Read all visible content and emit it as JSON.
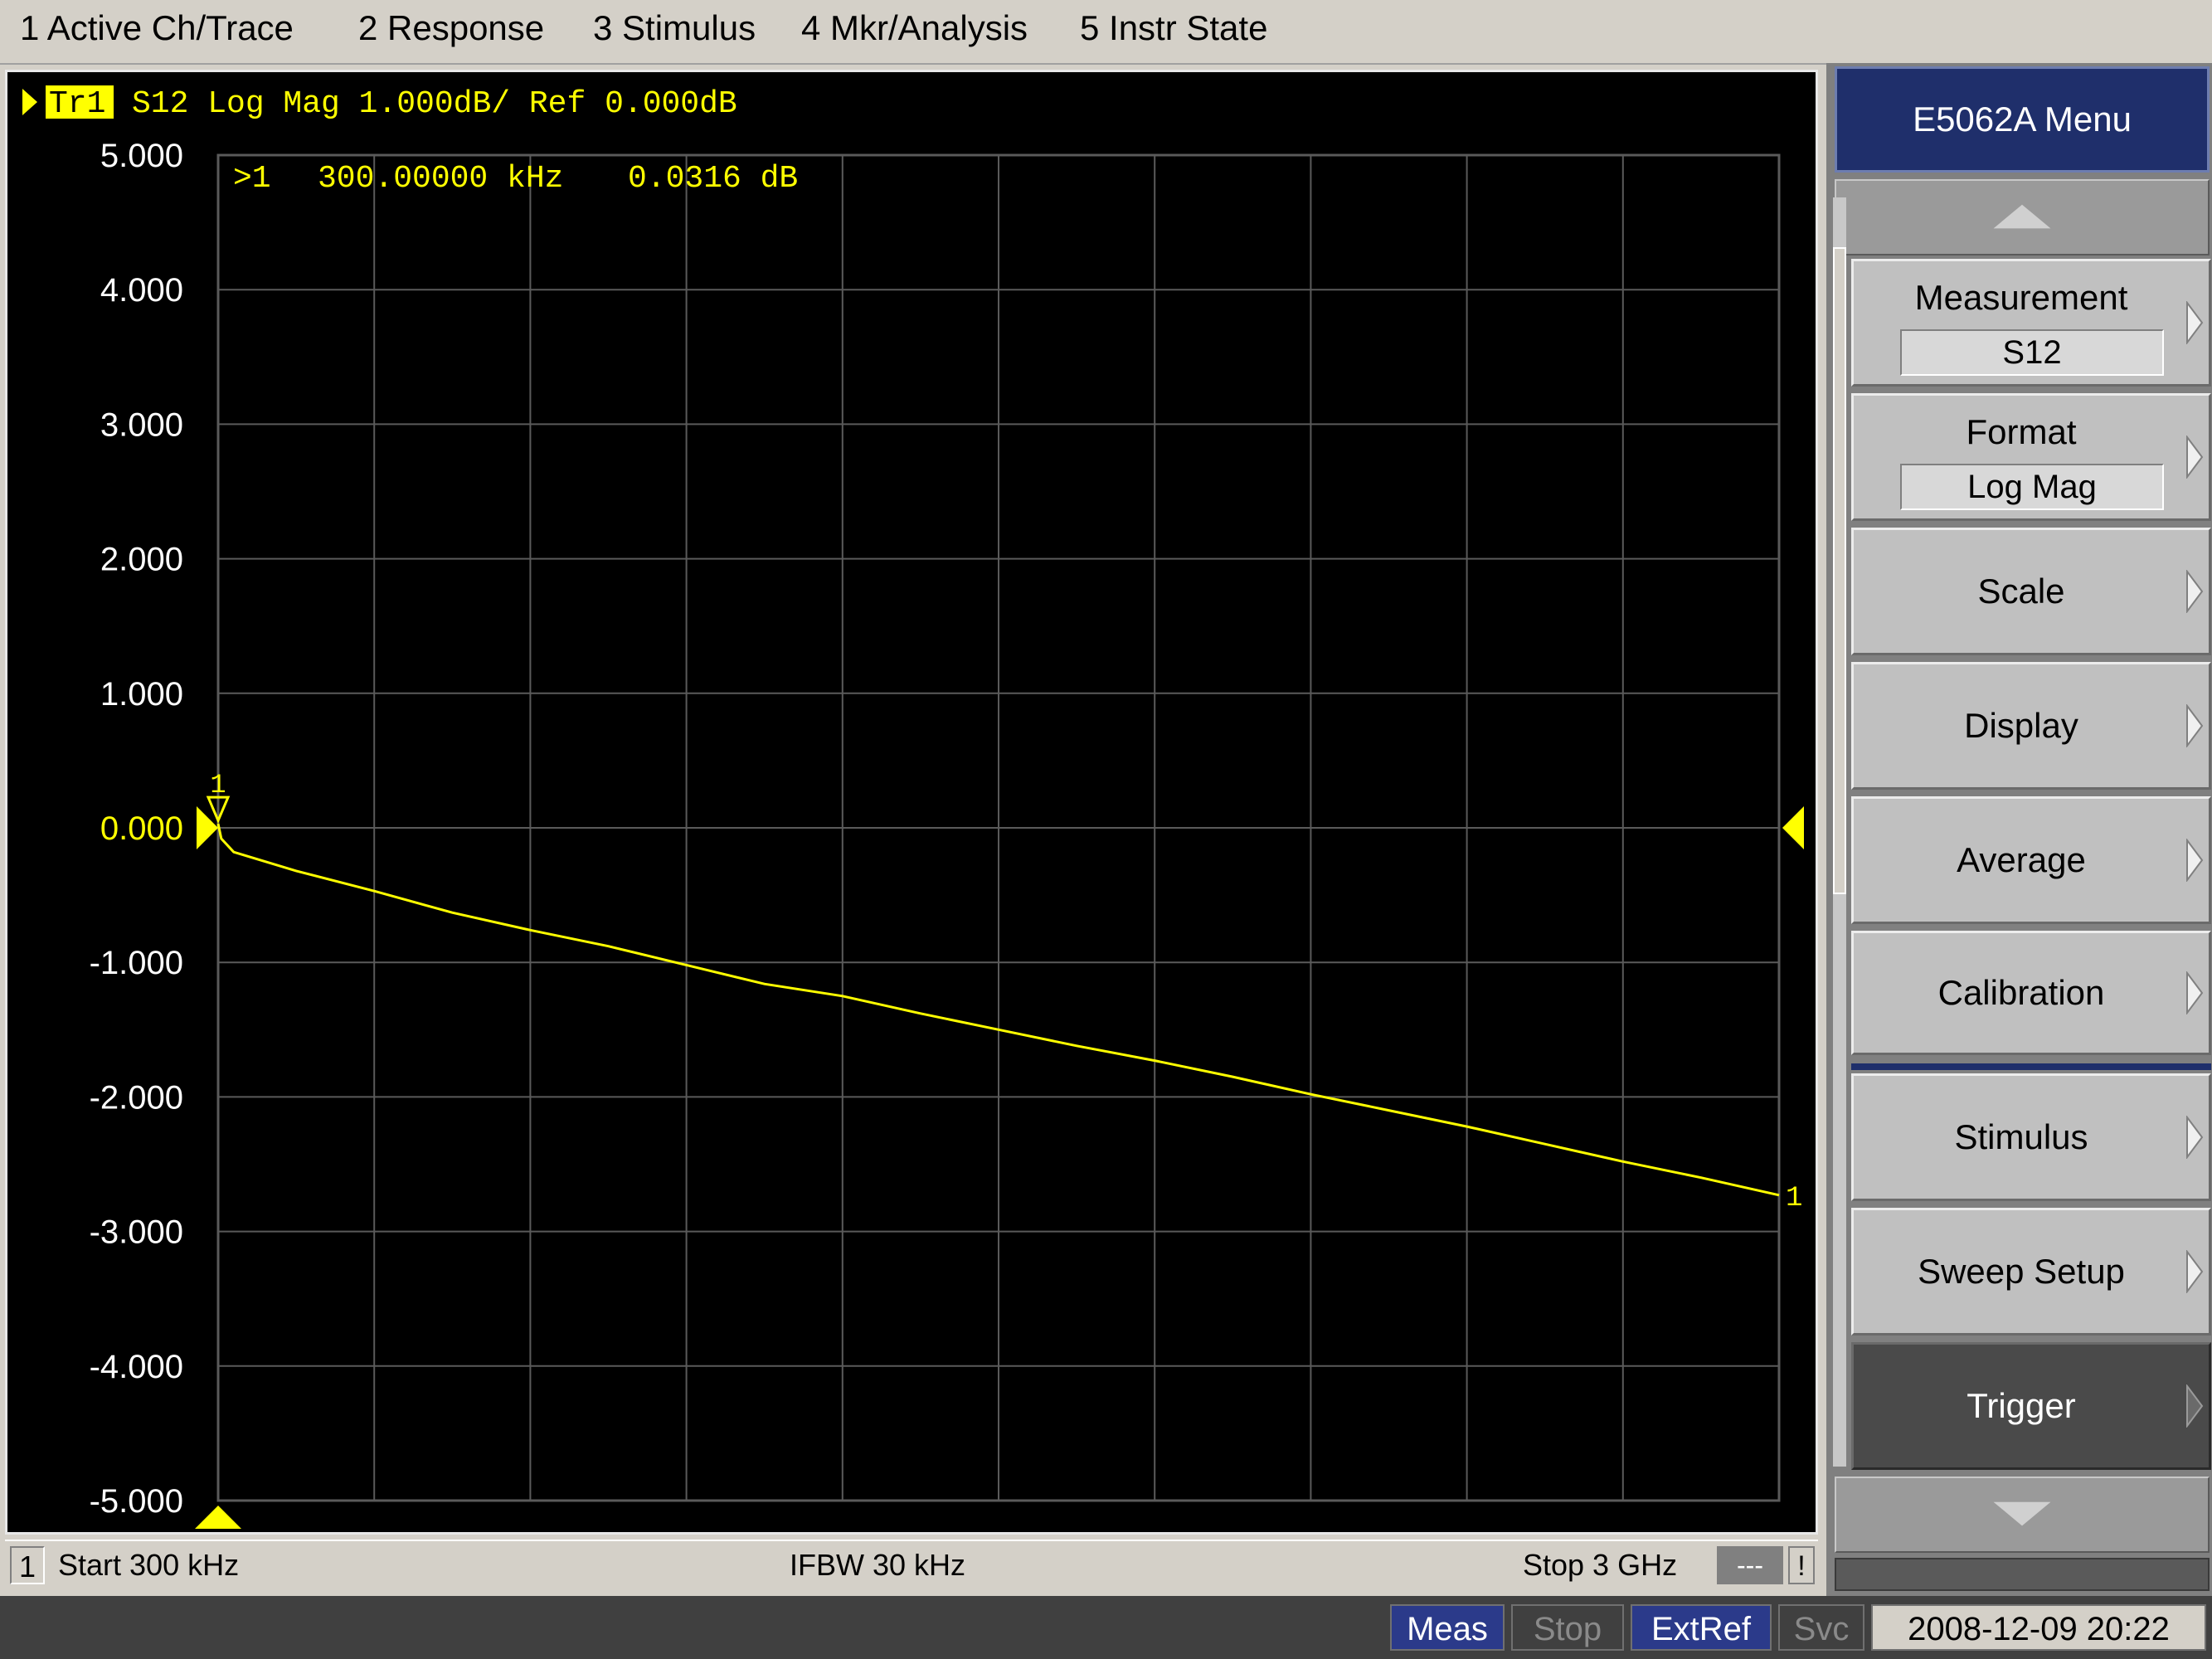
{
  "menubar": {
    "items": [
      "1 Active Ch/Trace",
      "2 Response",
      "3 Stimulus",
      "4 Mkr/Analysis",
      "5 Instr State"
    ]
  },
  "trace_header": {
    "trace_label": "Tr1",
    "text": "S12 Log Mag 1.000dB/ Ref 0.000dB"
  },
  "marker_readout": {
    "marker": ">1",
    "frequency": "300.00000 kHz",
    "value": "0.0316 dB"
  },
  "marker_flag": "1",
  "trace_end_label": "1",
  "chart_data": {
    "type": "line",
    "y_tick_labels": [
      "5.000",
      "4.000",
      "3.000",
      "2.000",
      "1.000",
      "0.000",
      "-1.000",
      "-2.000",
      "-3.000",
      "-4.000",
      "-5.000"
    ],
    "ylim": [
      -5,
      5
    ],
    "xlim": [
      0,
      10
    ],
    "x_divisions": 10,
    "y_divisions": 10,
    "ref_value": 0,
    "series": [
      {
        "color": "#ffff00",
        "x": [
          0,
          0.02,
          0.1,
          0.5,
          1.0,
          1.5,
          2.0,
          2.5,
          3.0,
          3.5,
          4.0,
          4.5,
          5.0,
          5.5,
          6.0,
          6.5,
          7.0,
          7.5,
          8.0,
          8.5,
          9.0,
          9.5,
          10.0
        ],
        "values": [
          0.03,
          -0.08,
          -0.18,
          -0.32,
          -0.47,
          -0.63,
          -0.76,
          -0.88,
          -1.02,
          -1.16,
          -1.25,
          -1.38,
          -1.5,
          -1.62,
          -1.73,
          -1.85,
          -1.98,
          -2.1,
          -2.22,
          -2.35,
          -2.48,
          -2.6,
          -2.73
        ]
      }
    ]
  },
  "channel_bar": {
    "channel": "1",
    "start": "Start 300 kHz",
    "ifbw": "IFBW 30 kHz",
    "stop": "Stop 3 GHz",
    "dash": "---",
    "warn": "!"
  },
  "softkeys": {
    "title": "E5062A Menu",
    "items": [
      {
        "label": "Measurement",
        "value": "S12"
      },
      {
        "label": "Format",
        "value": "Log Mag"
      },
      {
        "label": "Scale"
      },
      {
        "label": "Display"
      },
      {
        "label": "Average"
      },
      {
        "label": "Calibration"
      },
      {
        "label": "Stimulus"
      },
      {
        "label": "Sweep Setup"
      },
      {
        "label": "Trigger"
      }
    ]
  },
  "status": {
    "meas": "Meas",
    "stop": "Stop",
    "extref": "ExtRef",
    "svc": "Svc",
    "datetime": "2008-12-09 20:22"
  },
  "colors": {
    "trace": "#ffff00",
    "grid": "#5a5a5a",
    "menu_title_bg": "#1f2f6b",
    "status_active": "#2b3a8a"
  }
}
